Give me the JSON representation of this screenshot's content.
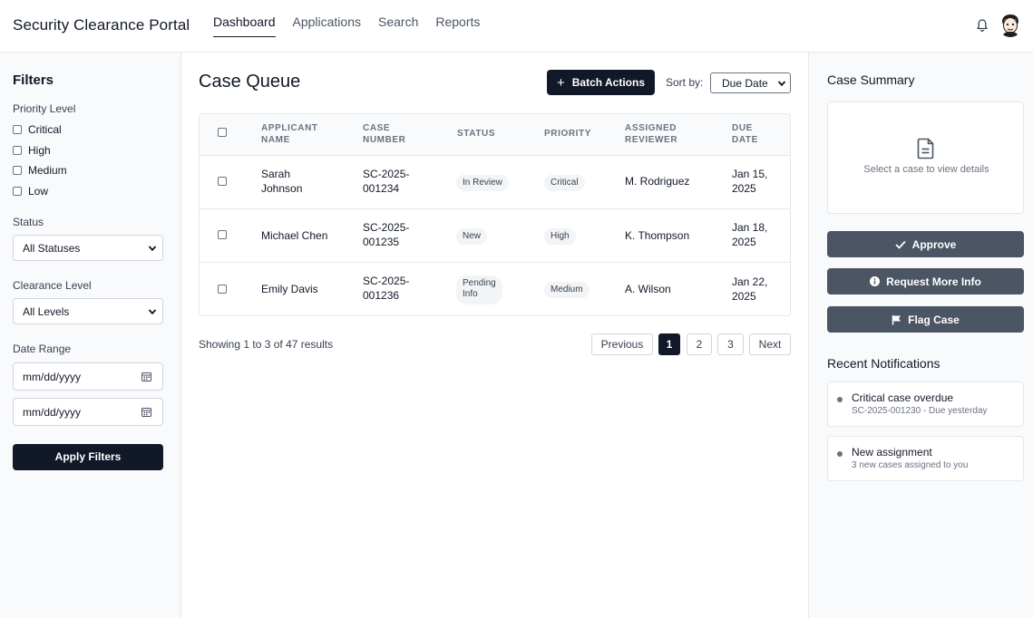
{
  "app": {
    "title": "Security Clearance Portal",
    "nav": [
      "Dashboard",
      "Applications",
      "Search",
      "Reports"
    ],
    "active_nav": "Dashboard",
    "bell_icon": "bell-icon",
    "avatar_icon": "avatar-icon"
  },
  "filters": {
    "title": "Filters",
    "priority_label": "Priority Level",
    "priorities": [
      "Critical",
      "High",
      "Medium",
      "Low"
    ],
    "status_label": "Status",
    "status_value": "All Statuses",
    "clearance_label": "Clearance Level",
    "clearance_value": "All Levels",
    "date_label": "Date Range",
    "date_from_placeholder": "mm/dd/yyyy",
    "date_to_placeholder": "mm/dd/yyyy",
    "apply_label": "Apply Filters"
  },
  "queue": {
    "title": "Case Queue",
    "batch_label": "Batch Actions",
    "sort_label": "Sort by:",
    "sort_value": "Due Date",
    "columns": [
      "Applicant Name",
      "Case Number",
      "Status",
      "Priority",
      "Assigned Reviewer",
      "Due Date"
    ],
    "rows": [
      {
        "name_1": "Sarah",
        "name_2": "Johnson",
        "case_1": "SC-2025-",
        "case_2": "001234",
        "status_1": "In Review",
        "status_2": "",
        "priority": "Critical",
        "reviewer": "M. Rodriguez",
        "due_1": "Jan 15,",
        "due_2": "2025"
      },
      {
        "name_1": "Michael Chen",
        "name_2": "",
        "case_1": "SC-2025-",
        "case_2": "001235",
        "status_1": "New",
        "status_2": "",
        "priority": "High",
        "reviewer": "K. Thompson",
        "due_1": "Jan 18,",
        "due_2": "2025"
      },
      {
        "name_1": "Emily Davis",
        "name_2": "",
        "case_1": "SC-2025-",
        "case_2": "001236",
        "status_1": "Pending",
        "status_2": "Info",
        "priority": "Medium",
        "reviewer": "A. Wilson",
        "due_1": "Jan 22,",
        "due_2": "2025"
      }
    ],
    "showing": "Showing 1 to 3 of 47 results",
    "pagination": {
      "previous": "Previous",
      "pages": [
        "1",
        "2",
        "3"
      ],
      "current": "1",
      "next": "Next"
    }
  },
  "summary": {
    "title": "Case Summary",
    "empty_text": "Select a case to view details",
    "actions": {
      "approve": "Approve",
      "request_info": "Request More Info",
      "flag": "Flag Case"
    }
  },
  "notifications": {
    "title": "Recent Notifications",
    "items": [
      {
        "title": "Critical case overdue",
        "sub": "SC-2025-001230 - Due yesterday"
      },
      {
        "title": "New assignment",
        "sub": "3 new cases assigned to you"
      }
    ]
  },
  "colors": {
    "primary": "#111827",
    "action": "#4b5563",
    "border": "#e5e7eb",
    "panel_bg": "#f9fafb"
  }
}
